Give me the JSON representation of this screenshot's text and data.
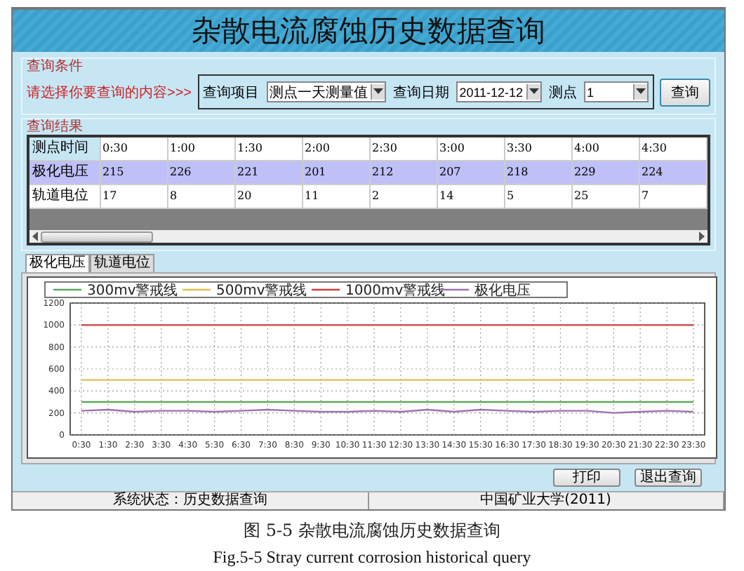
{
  "window": {
    "title": "杂散电流腐蚀历史数据查询"
  },
  "query": {
    "group_title": "查询条件",
    "prompt": "请选择你要查询的内容>>>",
    "fields": [
      {
        "label": "查询项目",
        "value": "测点一天测量值"
      },
      {
        "label": "查询日期",
        "value": "2011-12-12"
      },
      {
        "label": "测点",
        "value": "1"
      }
    ],
    "button": "查询"
  },
  "results": {
    "group_title": "查询结果",
    "rows": [
      {
        "label": "测点时间",
        "selected": false,
        "cells": [
          "0:30",
          "1:00",
          "1:30",
          "2:00",
          "2:30",
          "3:00",
          "3:30",
          "4:00",
          "4:30"
        ]
      },
      {
        "label": "极化电压",
        "selected": true,
        "cells": [
          "215",
          "226",
          "221",
          "201",
          "212",
          "207",
          "218",
          "229",
          "224"
        ]
      },
      {
        "label": "轨道电位",
        "selected": false,
        "cells": [
          "17",
          "8",
          "20",
          "11",
          "2",
          "14",
          "5",
          "25",
          "7"
        ]
      }
    ]
  },
  "tabs": [
    {
      "label": "极化电压",
      "selected": true
    },
    {
      "label": "轨道电位",
      "selected": false
    }
  ],
  "chart": {
    "chart_data": {
      "type": "line",
      "x": [
        "0:30",
        "1:30",
        "2:30",
        "3:30",
        "4:30",
        "5:30",
        "6:30",
        "7:30",
        "8:30",
        "9:30",
        "10:30",
        "11:30",
        "12:30",
        "13:30",
        "14:30",
        "15:30",
        "16:30",
        "17:30",
        "18:30",
        "19:30",
        "20:30",
        "21:30",
        "22:30",
        "23:30"
      ],
      "ylim": [
        0,
        1200
      ],
      "grid": true,
      "legend": true,
      "yticks": [
        0,
        200,
        400,
        600,
        800,
        1000,
        1200
      ],
      "series": [
        {
          "name": "300mv警戒线",
          "color": "#60a860",
          "values": [
            300,
            300,
            300,
            300,
            300,
            300,
            300,
            300,
            300,
            300,
            300,
            300,
            300,
            300,
            300,
            300,
            300,
            300,
            300,
            300,
            300,
            300,
            300,
            300
          ]
        },
        {
          "name": "500mv警戒线",
          "color": "#e0c050",
          "values": [
            500,
            500,
            500,
            500,
            500,
            500,
            500,
            500,
            500,
            500,
            500,
            500,
            500,
            500,
            500,
            500,
            500,
            500,
            500,
            500,
            500,
            500,
            500,
            500
          ]
        },
        {
          "name": "1000mv警戒线",
          "color": "#d04040",
          "values": [
            1000,
            1000,
            1000,
            1000,
            1000,
            1000,
            1000,
            1000,
            1000,
            1000,
            1000,
            1000,
            1000,
            1000,
            1000,
            1000,
            1000,
            1000,
            1000,
            1000,
            1000,
            1000,
            1000,
            1000
          ]
        },
        {
          "name": "极化电压",
          "color": "#a070b0",
          "values": [
            220,
            230,
            210,
            220,
            220,
            210,
            220,
            230,
            220,
            210,
            210,
            220,
            210,
            230,
            210,
            230,
            220,
            210,
            220,
            220,
            200,
            210,
            220,
            210
          ]
        }
      ]
    }
  },
  "buttons": [
    "打印",
    "退出查询"
  ],
  "status_bar": [
    "系统状态：历史数据查询",
    "中国矿业大学(2011)"
  ],
  "caption": {
    "chinese": "图 5-5 杂散电流腐蚀历史数据查询",
    "english": "Fig.5-5 Stray current corrosion historical query"
  }
}
